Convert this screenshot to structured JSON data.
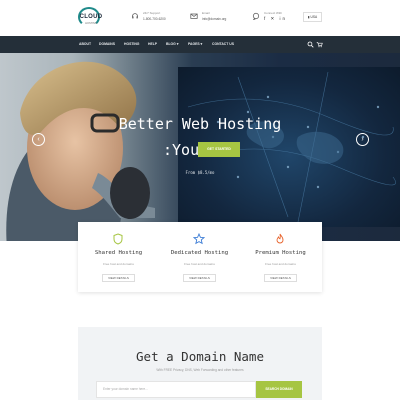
{
  "brand": {
    "logo_name": "CLOUD",
    "logo_tagline": "HOSTING"
  },
  "header": {
    "phone": {
      "label": "24/7 Support",
      "value": "1-800-700-6200"
    },
    "email": {
      "label": "Email",
      "value": "info@domain.org"
    },
    "follow": {
      "label": "Connect With",
      "icons": "f ✕ in"
    },
    "language": "▮ USA"
  },
  "nav": {
    "items": [
      "ABOUT",
      "DOMAINS",
      "HOSTING",
      "HELP",
      "BLOG ▾",
      "PAGES ▾",
      "CONTACT US"
    ]
  },
  "hero": {
    "title_line1": "Better Web Hosting",
    "title_line2": ":You",
    "cta": "GET STARTED",
    "subtitle": "From $8.5/mo",
    "prev": "‹",
    "next": "›"
  },
  "cards": [
    {
      "title": "Shared Hosting",
      "desc": "Free host and domains",
      "button": "VIEW DETAILS",
      "icon": "shield-icon"
    },
    {
      "title": "Dedicated Hosting",
      "desc": "Free host and domains",
      "button": "VIEW DETAILS",
      "icon": "star-icon"
    },
    {
      "title": "Premium Hosting",
      "desc": "Free host and domains",
      "button": "VIEW DETAILS",
      "icon": "flame-icon"
    }
  ],
  "domain": {
    "title": "Get a Domain Name",
    "subtitle": "With FREE Privacy, DNS, Web Forwarding and other features",
    "placeholder": "Enter your domain name here...",
    "button": "SEARCH DOMAIN"
  },
  "colors": {
    "accent": "#a6c542",
    "nav_bg": "#242f39",
    "brand": "#1f8a8a"
  }
}
